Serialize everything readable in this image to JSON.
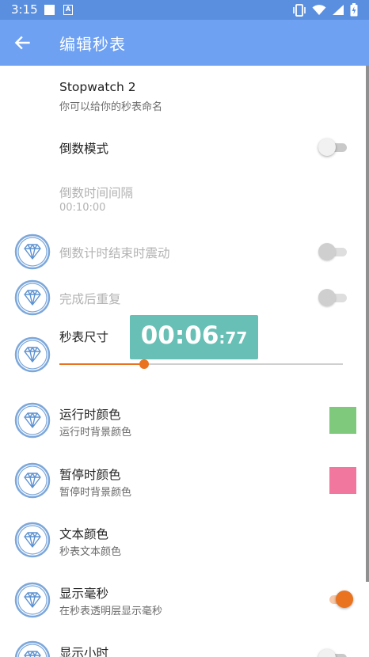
{
  "status_bar": {
    "time": "3:15"
  },
  "app_bar": {
    "title": "编辑秒表",
    "back_icon": "arrow-left-icon"
  },
  "settings": {
    "name": {
      "title": "Stopwatch 2",
      "subtitle": "你可以给你的秒表命名"
    },
    "countdown_mode": {
      "title": "倒数模式",
      "enabled": false
    },
    "countdown_interval": {
      "title": "倒数时间间隔",
      "value": "00:10:00"
    },
    "vibrate_on_end": {
      "title": "倒数计时结束时震动",
      "enabled": false
    },
    "repeat_after_done": {
      "title": "完成后重复",
      "enabled": false
    },
    "size": {
      "title": "秒表尺寸",
      "preview_main": "00:06",
      "preview_ms": ":77",
      "slider_fraction": 0.3
    },
    "running_color": {
      "title": "运行时颜色",
      "subtitle": "运行时背景颜色",
      "color": "#7ec97b"
    },
    "paused_color": {
      "title": "暂停时颜色",
      "subtitle": "暂停时背景颜色",
      "color": "#f2779f"
    },
    "text_color": {
      "title": "文本颜色",
      "subtitle": "秒表文本颜色"
    },
    "show_ms": {
      "title": "显示毫秒",
      "subtitle": "在秒表透明层显示毫秒",
      "enabled": true
    },
    "show_hours": {
      "title": "显示小时",
      "enabled": false
    }
  },
  "colors": {
    "status_bar": "#5a8fe0",
    "app_bar": "#6ea1f2",
    "accent": "#e9731e",
    "preview_bg": "#67bfb5"
  }
}
